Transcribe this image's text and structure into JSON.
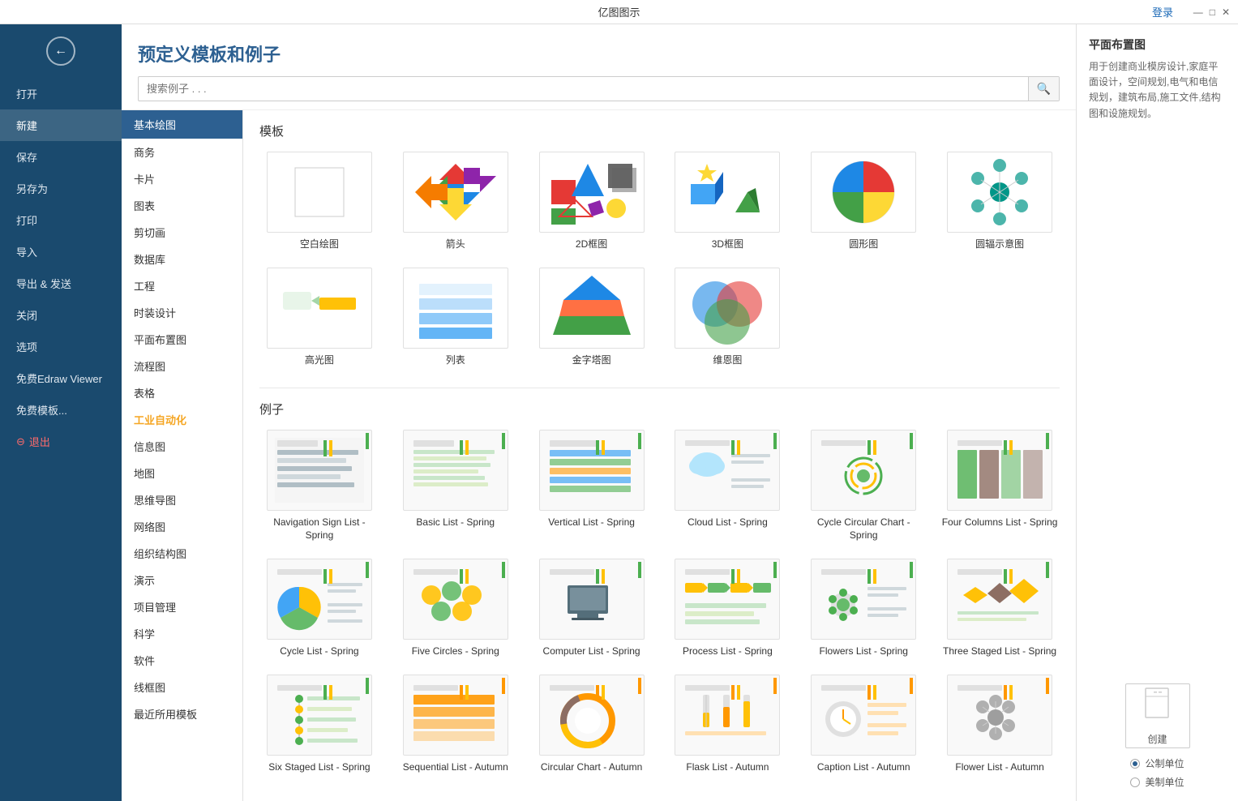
{
  "titleBar": {
    "title": "亿图图示",
    "login": "登录",
    "controls": [
      "—",
      "□",
      "✕"
    ]
  },
  "sidebar": {
    "back_label": "←",
    "items": [
      {
        "label": "打开",
        "id": "open"
      },
      {
        "label": "新建",
        "id": "new",
        "active": true
      },
      {
        "label": "保存",
        "id": "save"
      },
      {
        "label": "另存为",
        "id": "save-as"
      },
      {
        "label": "打印",
        "id": "print"
      },
      {
        "label": "导入",
        "id": "import"
      },
      {
        "label": "导出 & 发送",
        "id": "export"
      },
      {
        "label": "关闭",
        "id": "close"
      },
      {
        "label": "选项",
        "id": "options"
      },
      {
        "label": "免费Edraw Viewer",
        "id": "viewer"
      },
      {
        "label": "免费模板...",
        "id": "templates"
      },
      {
        "label": "退出",
        "id": "exit",
        "danger": true
      }
    ]
  },
  "header": {
    "title": "预定义模板和例子",
    "search_placeholder": "搜索例子 . . ."
  },
  "categorySidebar": {
    "selected": "基本绘图",
    "items": [
      {
        "label": "基本绘图",
        "active": true
      },
      {
        "label": "商务"
      },
      {
        "label": "卡片"
      },
      {
        "label": "图表"
      },
      {
        "label": "剪切画"
      },
      {
        "label": "数据库"
      },
      {
        "label": "工程"
      },
      {
        "label": "时装设计"
      },
      {
        "label": "平面布置图"
      },
      {
        "label": "流程图"
      },
      {
        "label": "表格"
      },
      {
        "label": "工业自动化",
        "highlight": true
      },
      {
        "label": "信息图"
      },
      {
        "label": "地图"
      },
      {
        "label": "思维导图"
      },
      {
        "label": "网络图"
      },
      {
        "label": "组织结构图"
      },
      {
        "label": "演示"
      },
      {
        "label": "项目管理"
      },
      {
        "label": "科学"
      },
      {
        "label": "软件"
      },
      {
        "label": "线框图"
      },
      {
        "label": "最近所用模板"
      }
    ]
  },
  "templates": {
    "section_label": "模板",
    "items": [
      {
        "id": "blank",
        "label": "空白绘图",
        "type": "blank"
      },
      {
        "id": "arrow",
        "label": "箭头",
        "type": "arrow"
      },
      {
        "id": "2d",
        "label": "2D框图",
        "type": "2d"
      },
      {
        "id": "3d",
        "label": "3D框图",
        "type": "3d"
      },
      {
        "id": "circle",
        "label": "圆形图",
        "type": "circle"
      },
      {
        "id": "radiation",
        "label": "圆辐示意图",
        "type": "radiation"
      },
      {
        "id": "highlight",
        "label": "高光图",
        "type": "highlight"
      },
      {
        "id": "list",
        "label": "列表",
        "type": "list"
      },
      {
        "id": "pyramid",
        "label": "金字塔图",
        "type": "pyramid"
      },
      {
        "id": "venn",
        "label": "维恩图",
        "type": "venn"
      }
    ]
  },
  "examples": {
    "section_label": "例子",
    "items": [
      {
        "id": "nav-sign",
        "label": "Navigation Sign List - Spring",
        "row": 1
      },
      {
        "id": "basic-list",
        "label": "Basic List - Spring",
        "row": 1
      },
      {
        "id": "vertical-list",
        "label": "Vertical List - Spring",
        "row": 1
      },
      {
        "id": "cloud-list",
        "label": "Cloud List - Spring",
        "row": 1
      },
      {
        "id": "cycle-circular",
        "label": "Cycle Circular Chart - Spring",
        "row": 1
      },
      {
        "id": "four-columns",
        "label": "Four Columns List - Spring",
        "row": 1
      },
      {
        "id": "cycle-list",
        "label": "Cycle List - Spring",
        "row": 2
      },
      {
        "id": "five-circles",
        "label": "Five Circles - Spring",
        "row": 2
      },
      {
        "id": "computer-list",
        "label": "Computer List - Spring",
        "row": 2
      },
      {
        "id": "process-list",
        "label": "Process List - Spring",
        "row": 2
      },
      {
        "id": "flowers-list",
        "label": "Flowers List - Spring",
        "row": 2
      },
      {
        "id": "three-staged",
        "label": "Three Staged List - Spring",
        "row": 2
      },
      {
        "id": "six-staged",
        "label": "Six Staged List - Spring",
        "row": 3
      },
      {
        "id": "sequential",
        "label": "Sequential List - Autumn",
        "row": 3
      },
      {
        "id": "circular-chart",
        "label": "Circular Chart - Autumn",
        "row": 3
      },
      {
        "id": "flask-list",
        "label": "Flask List - Autumn",
        "row": 3
      },
      {
        "id": "caption-list",
        "label": "Caption List - Autumn",
        "row": 3
      },
      {
        "id": "flower-list",
        "label": "Flower List - Autumn",
        "row": 3
      }
    ]
  },
  "rightPanel": {
    "title": "平面布置图",
    "description": "用于创建商业模房设计,家庭平面设计，空间规划,电气和电信规划，建筑布局,施工文件,结构图和设施规划。",
    "create_label": "创建",
    "units": [
      {
        "label": "公制单位",
        "checked": true
      },
      {
        "label": "美制单位",
        "checked": false
      }
    ]
  }
}
